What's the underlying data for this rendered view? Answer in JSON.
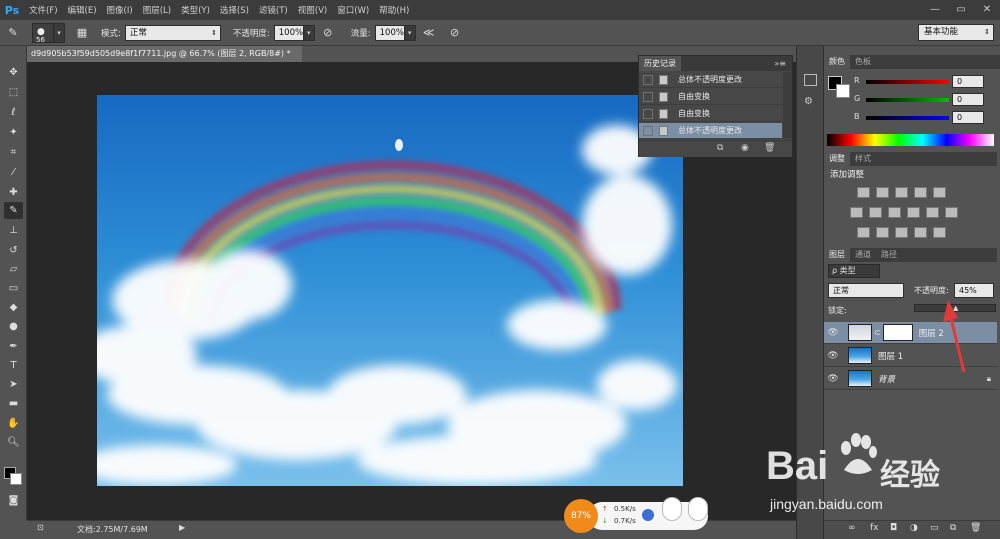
{
  "app": {
    "logo": "Ps"
  },
  "menu": [
    "文件(F)",
    "编辑(E)",
    "图像(I)",
    "图层(L)",
    "类型(Y)",
    "选择(S)",
    "滤镜(T)",
    "视图(V)",
    "窗口(W)",
    "帮助(H)"
  ],
  "window_controls": [
    "—",
    "▭",
    "✕"
  ],
  "options": {
    "brush_size": "56",
    "mode_label": "模式:",
    "mode_value": "正常",
    "opacity_label": "不透明度:",
    "opacity_value": "100%",
    "flow_label": "流量:",
    "flow_value": "100%",
    "workspace": "基本功能"
  },
  "document": {
    "tab_title": "d9d905b53f59d505d9e8f1f7711.jpg @ 66.7% (图层 2, RGB/8#) *",
    "status": "文档:2.75M/7.69M"
  },
  "history": {
    "title": "历史记录",
    "items": [
      {
        "label": "总体不透明度更改",
        "selected": false
      },
      {
        "label": "自由变换",
        "selected": false
      },
      {
        "label": "自由变换",
        "selected": false
      },
      {
        "label": "总体不透明度更改",
        "selected": true
      }
    ]
  },
  "color_panel": {
    "tabs": [
      "颜色",
      "色板"
    ],
    "channels": [
      {
        "label": "R",
        "value": "0",
        "color": "#ff0000"
      },
      {
        "label": "G",
        "value": "0",
        "color": "#00c000"
      },
      {
        "label": "B",
        "value": "0",
        "color": "#0000ff"
      }
    ]
  },
  "adjustments_panel": {
    "tabs": [
      "调整",
      "样式"
    ],
    "heading": "添加调整"
  },
  "layers_panel": {
    "tabs": [
      "图层",
      "通道",
      "路径"
    ],
    "filter_label": "ρ 类型",
    "blend_mode": "正常",
    "opacity_label": "不透明度:",
    "opacity_value": "45%",
    "lock_label": "锁定:",
    "layers": [
      {
        "name": "图层 2",
        "selected": true,
        "italic": false
      },
      {
        "name": "图层 1",
        "selected": false,
        "italic": false
      },
      {
        "name": "背景",
        "selected": false,
        "italic": true
      }
    ]
  },
  "net_widget": {
    "percent": "87%",
    "up": "0.5K/s",
    "down": "0.7K/s"
  },
  "watermark": {
    "brand": "Bai",
    "brand_cn": "经验",
    "url": "jingyan.baidu.com"
  }
}
